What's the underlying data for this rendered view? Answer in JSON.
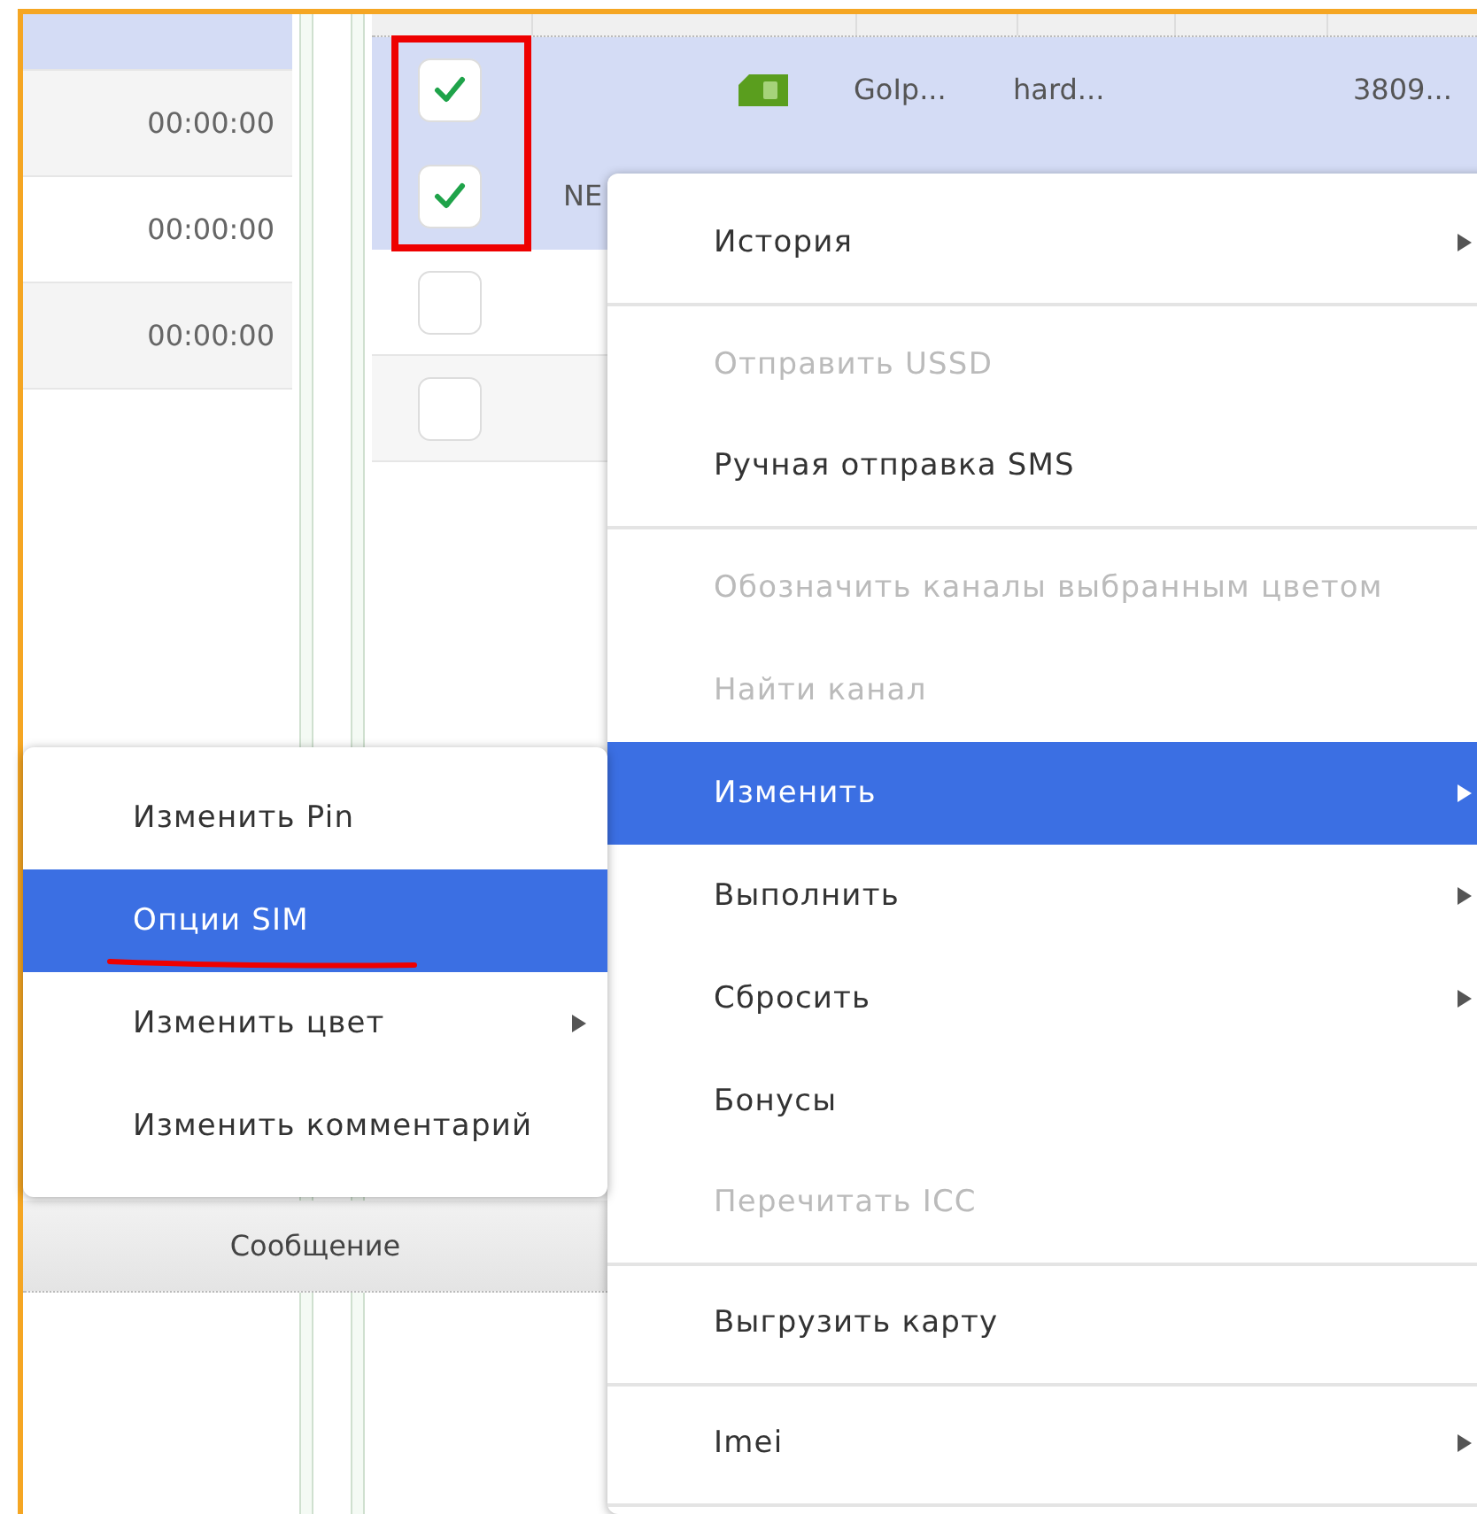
{
  "time_panel": {
    "rows": [
      {
        "selected": true
      },
      {
        "time": "00:00:00",
        "selected": false
      },
      {
        "time": "00:00:00",
        "selected": false
      },
      {
        "time": "00:00:00",
        "selected": false
      }
    ]
  },
  "channel_table": {
    "rows": [
      {
        "checked": true,
        "selected": true,
        "sim_icon": true,
        "column_4": "GoIp...",
        "column_5": "hard...",
        "column_6": "3809..."
      },
      {
        "checked": true,
        "selected": true,
        "column_2": "NE"
      },
      {
        "checked": false,
        "selected": false
      },
      {
        "checked": false,
        "selected": false
      }
    ]
  },
  "bottom_tab": {
    "label": "Сообщение"
  },
  "context_menu": {
    "items": [
      {
        "label": "История",
        "disabled": false,
        "submenu": true,
        "selected": false,
        "separator_after": true
      },
      {
        "label": "Отправить USSD",
        "disabled": true,
        "submenu": false,
        "selected": false,
        "separator_after": false
      },
      {
        "label": "Ручная отправка SMS",
        "disabled": false,
        "submenu": false,
        "selected": false,
        "separator_after": true
      },
      {
        "label": "Обозначить каналы выбранным цветом",
        "disabled": true,
        "submenu": false,
        "selected": false,
        "separator_after": false
      },
      {
        "label": "Найти канал",
        "disabled": true,
        "submenu": false,
        "selected": false,
        "separator_after": false
      },
      {
        "label": "Изменить",
        "disabled": false,
        "submenu": true,
        "selected": true,
        "separator_after": false
      },
      {
        "label": "Выполнить",
        "disabled": false,
        "submenu": true,
        "selected": false,
        "separator_after": false
      },
      {
        "label": "Сбросить",
        "disabled": false,
        "submenu": true,
        "selected": false,
        "separator_after": false
      },
      {
        "label": "Бонусы",
        "disabled": false,
        "submenu": false,
        "selected": false,
        "separator_after": false
      },
      {
        "label": "Перечитать ICC",
        "disabled": true,
        "submenu": false,
        "selected": false,
        "separator_after": true
      },
      {
        "label": "Выгрузить карту",
        "disabled": false,
        "submenu": false,
        "selected": false,
        "separator_after": true
      },
      {
        "label": "Imei",
        "disabled": false,
        "submenu": true,
        "selected": false,
        "separator_after": true
      }
    ]
  },
  "submenu": {
    "items": [
      {
        "label": "Изменить Pin",
        "submenu": false,
        "selected": false
      },
      {
        "label": "Опции SIM",
        "submenu": false,
        "selected": true
      },
      {
        "label": "Изменить цвет",
        "submenu": true,
        "selected": false
      },
      {
        "label": "Изменить комментарий",
        "submenu": false,
        "selected": false
      }
    ]
  }
}
